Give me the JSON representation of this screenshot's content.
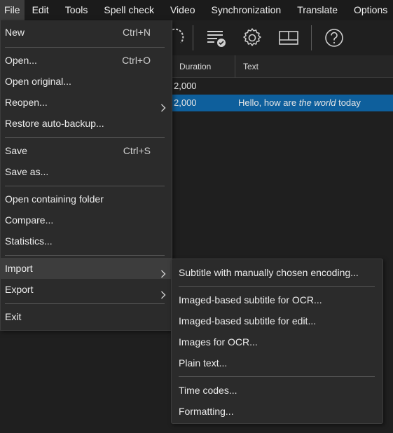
{
  "menubar": {
    "items": [
      "File",
      "Edit",
      "Tools",
      "Spell check",
      "Video",
      "Synchronization",
      "Translate",
      "Options"
    ]
  },
  "toolbar": {
    "icons": [
      "sync-icon",
      "list-check-icon",
      "gear-icon",
      "layout-icon",
      "help-icon"
    ]
  },
  "grid": {
    "columns": [
      "Duration",
      "Text"
    ],
    "rows": [
      {
        "duration": "2,000",
        "text_before": "",
        "text_italic": "",
        "text_after": "",
        "selected": false
      },
      {
        "duration": "2,000",
        "text_before": "Hello, how are ",
        "text_italic": "the world",
        "text_after": " today",
        "selected": true
      }
    ]
  },
  "file_menu": {
    "items": [
      {
        "label": "New",
        "shortcut": "Ctrl+N"
      },
      {
        "label": "Open...",
        "shortcut": "Ctrl+O"
      },
      {
        "label": "Open original...",
        "shortcut": ""
      },
      {
        "label": "Reopen...",
        "shortcut": ""
      },
      {
        "label": "Restore auto-backup...",
        "shortcut": ""
      },
      {
        "label": "Save",
        "shortcut": "Ctrl+S"
      },
      {
        "label": "Save as...",
        "shortcut": ""
      },
      {
        "label": "Open containing folder",
        "shortcut": ""
      },
      {
        "label": "Compare...",
        "shortcut": ""
      },
      {
        "label": "Statistics...",
        "shortcut": ""
      },
      {
        "label": "Import",
        "shortcut": ""
      },
      {
        "label": "Export",
        "shortcut": ""
      },
      {
        "label": "Exit",
        "shortcut": ""
      }
    ]
  },
  "import_submenu": {
    "items": [
      "Subtitle with manually chosen encoding...",
      "Imaged-based subtitle for OCR...",
      "Imaged-based subtitle for edit...",
      "Images for OCR...",
      "Plain text...",
      "Time codes...",
      "Formatting..."
    ]
  },
  "colors": {
    "selection": "#0e5f9c",
    "menu_bg": "#2b2b2b",
    "background": "#1f1f1f"
  }
}
